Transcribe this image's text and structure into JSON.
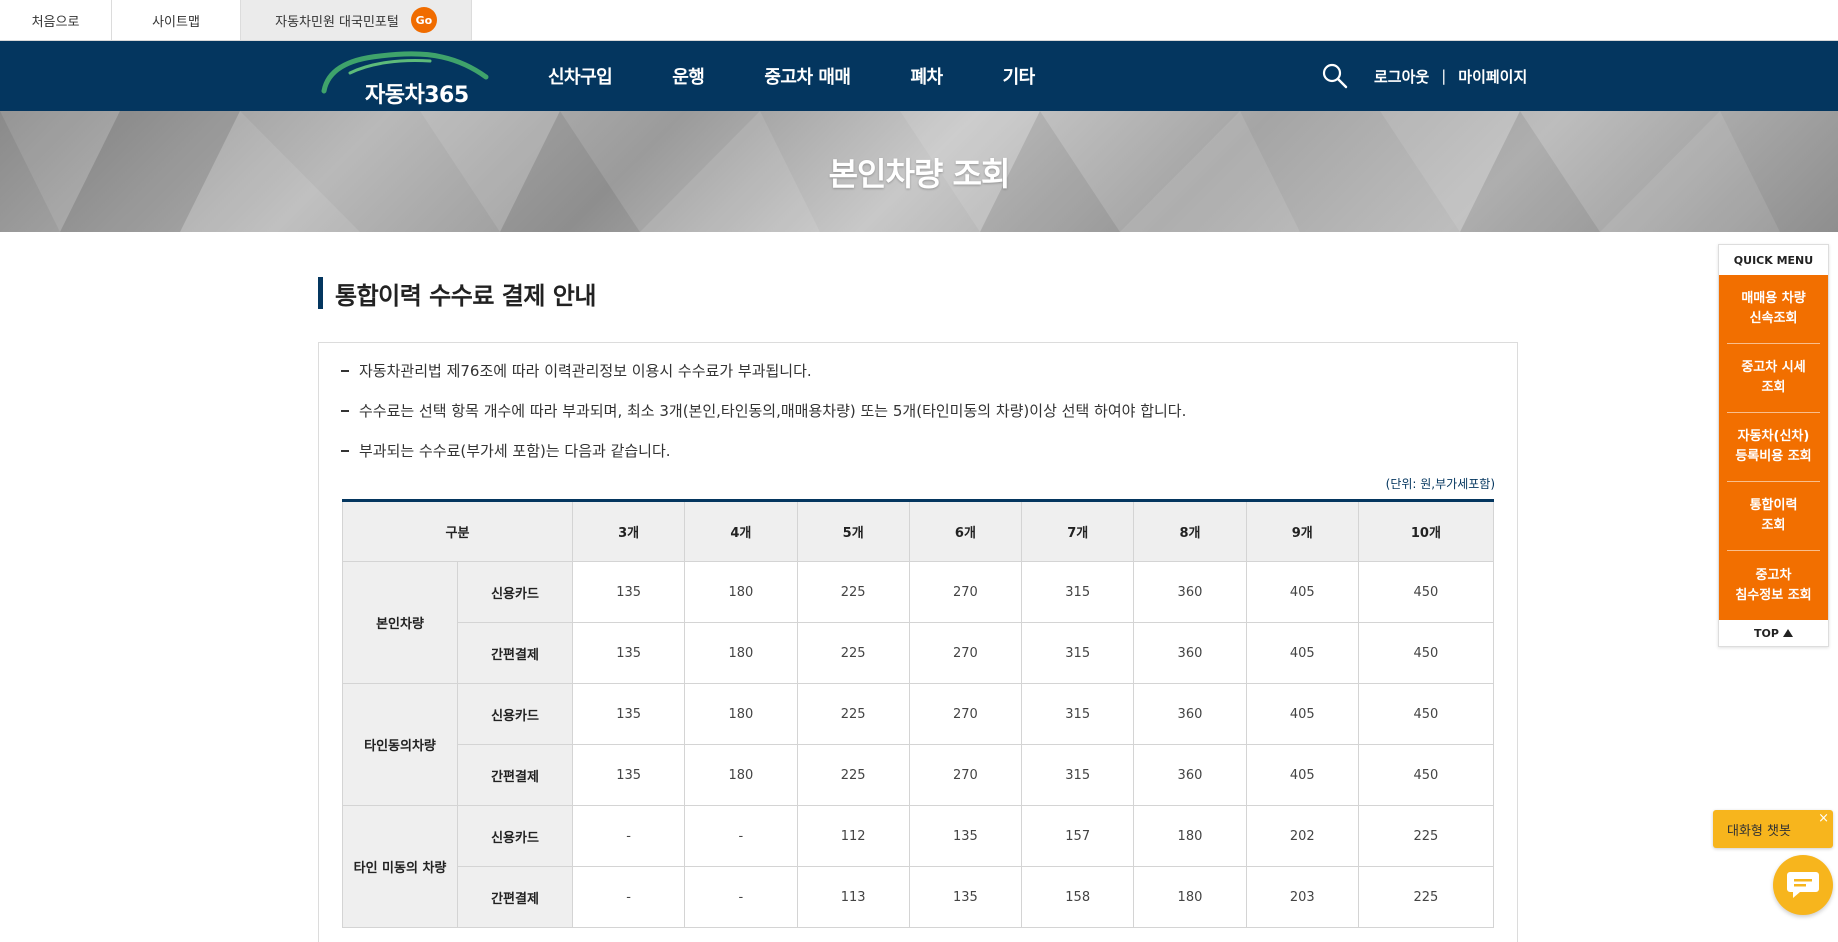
{
  "utility": {
    "home": "처음으로",
    "sitemap": "사이트맵",
    "portal": "자동차민원 대국민포털",
    "go": "Go"
  },
  "header": {
    "logo_text": "자동차365",
    "menu": [
      "신차구입",
      "운행",
      "중고차 매매",
      "폐차",
      "기타"
    ],
    "logout": "로그아웃",
    "separator": "|",
    "mypage": "마이페이지"
  },
  "banner": {
    "title": "본인차량 조회"
  },
  "section": {
    "title": "통합이력 수수료 결제 안내",
    "notes": [
      "자동차관리법 제76조에 따라 이력관리정보 이용시 수수료가 부과됩니다.",
      "수수료는 선택 항목 개수에 따라 부과되며, 최소 3개(본인,타인동의,매매용차량) 또는 5개(타인미동의 차량)이상 선택 하여야 합니다.",
      "부과되는 수수료(부가세 포함)는 다음과 같습니다."
    ],
    "unit": "(단위: 원,부가세포함)"
  },
  "fee_table": {
    "header_label": "구분",
    "columns": [
      "3개",
      "4개",
      "5개",
      "6개",
      "7개",
      "8개",
      "9개",
      "10개"
    ],
    "groups": [
      {
        "name": "본인차량",
        "rows": [
          {
            "method": "신용카드",
            "values": [
              "135",
              "180",
              "225",
              "270",
              "315",
              "360",
              "405",
              "450"
            ]
          },
          {
            "method": "간편결제",
            "values": [
              "135",
              "180",
              "225",
              "270",
              "315",
              "360",
              "405",
              "450"
            ]
          }
        ]
      },
      {
        "name": "타인동의차량",
        "rows": [
          {
            "method": "신용카드",
            "values": [
              "135",
              "180",
              "225",
              "270",
              "315",
              "360",
              "405",
              "450"
            ]
          },
          {
            "method": "간편결제",
            "values": [
              "135",
              "180",
              "225",
              "270",
              "315",
              "360",
              "405",
              "450"
            ]
          }
        ]
      },
      {
        "name": "타인 미동의 차량",
        "rows": [
          {
            "method": "신용카드",
            "values": [
              "-",
              "-",
              "112",
              "135",
              "157",
              "180",
              "202",
              "225"
            ]
          },
          {
            "method": "간편결제",
            "values": [
              "-",
              "-",
              "113",
              "135",
              "158",
              "180",
              "203",
              "225"
            ]
          }
        ]
      }
    ]
  },
  "quick_menu": {
    "title": "QUICK MENU",
    "items": [
      "매매용 차량\n신속조회",
      "중고차 시세\n조회",
      "자동차(신차)\n등록비용 조회",
      "통합이력\n조회",
      "중고차\n침수정보 조회"
    ],
    "top": "TOP"
  },
  "chatbot": {
    "label": "대화형 챗봇",
    "close": "×"
  },
  "colors": {
    "navy": "#04365f",
    "orange": "#f26f00",
    "chat_yellow": "#f7b51d"
  }
}
